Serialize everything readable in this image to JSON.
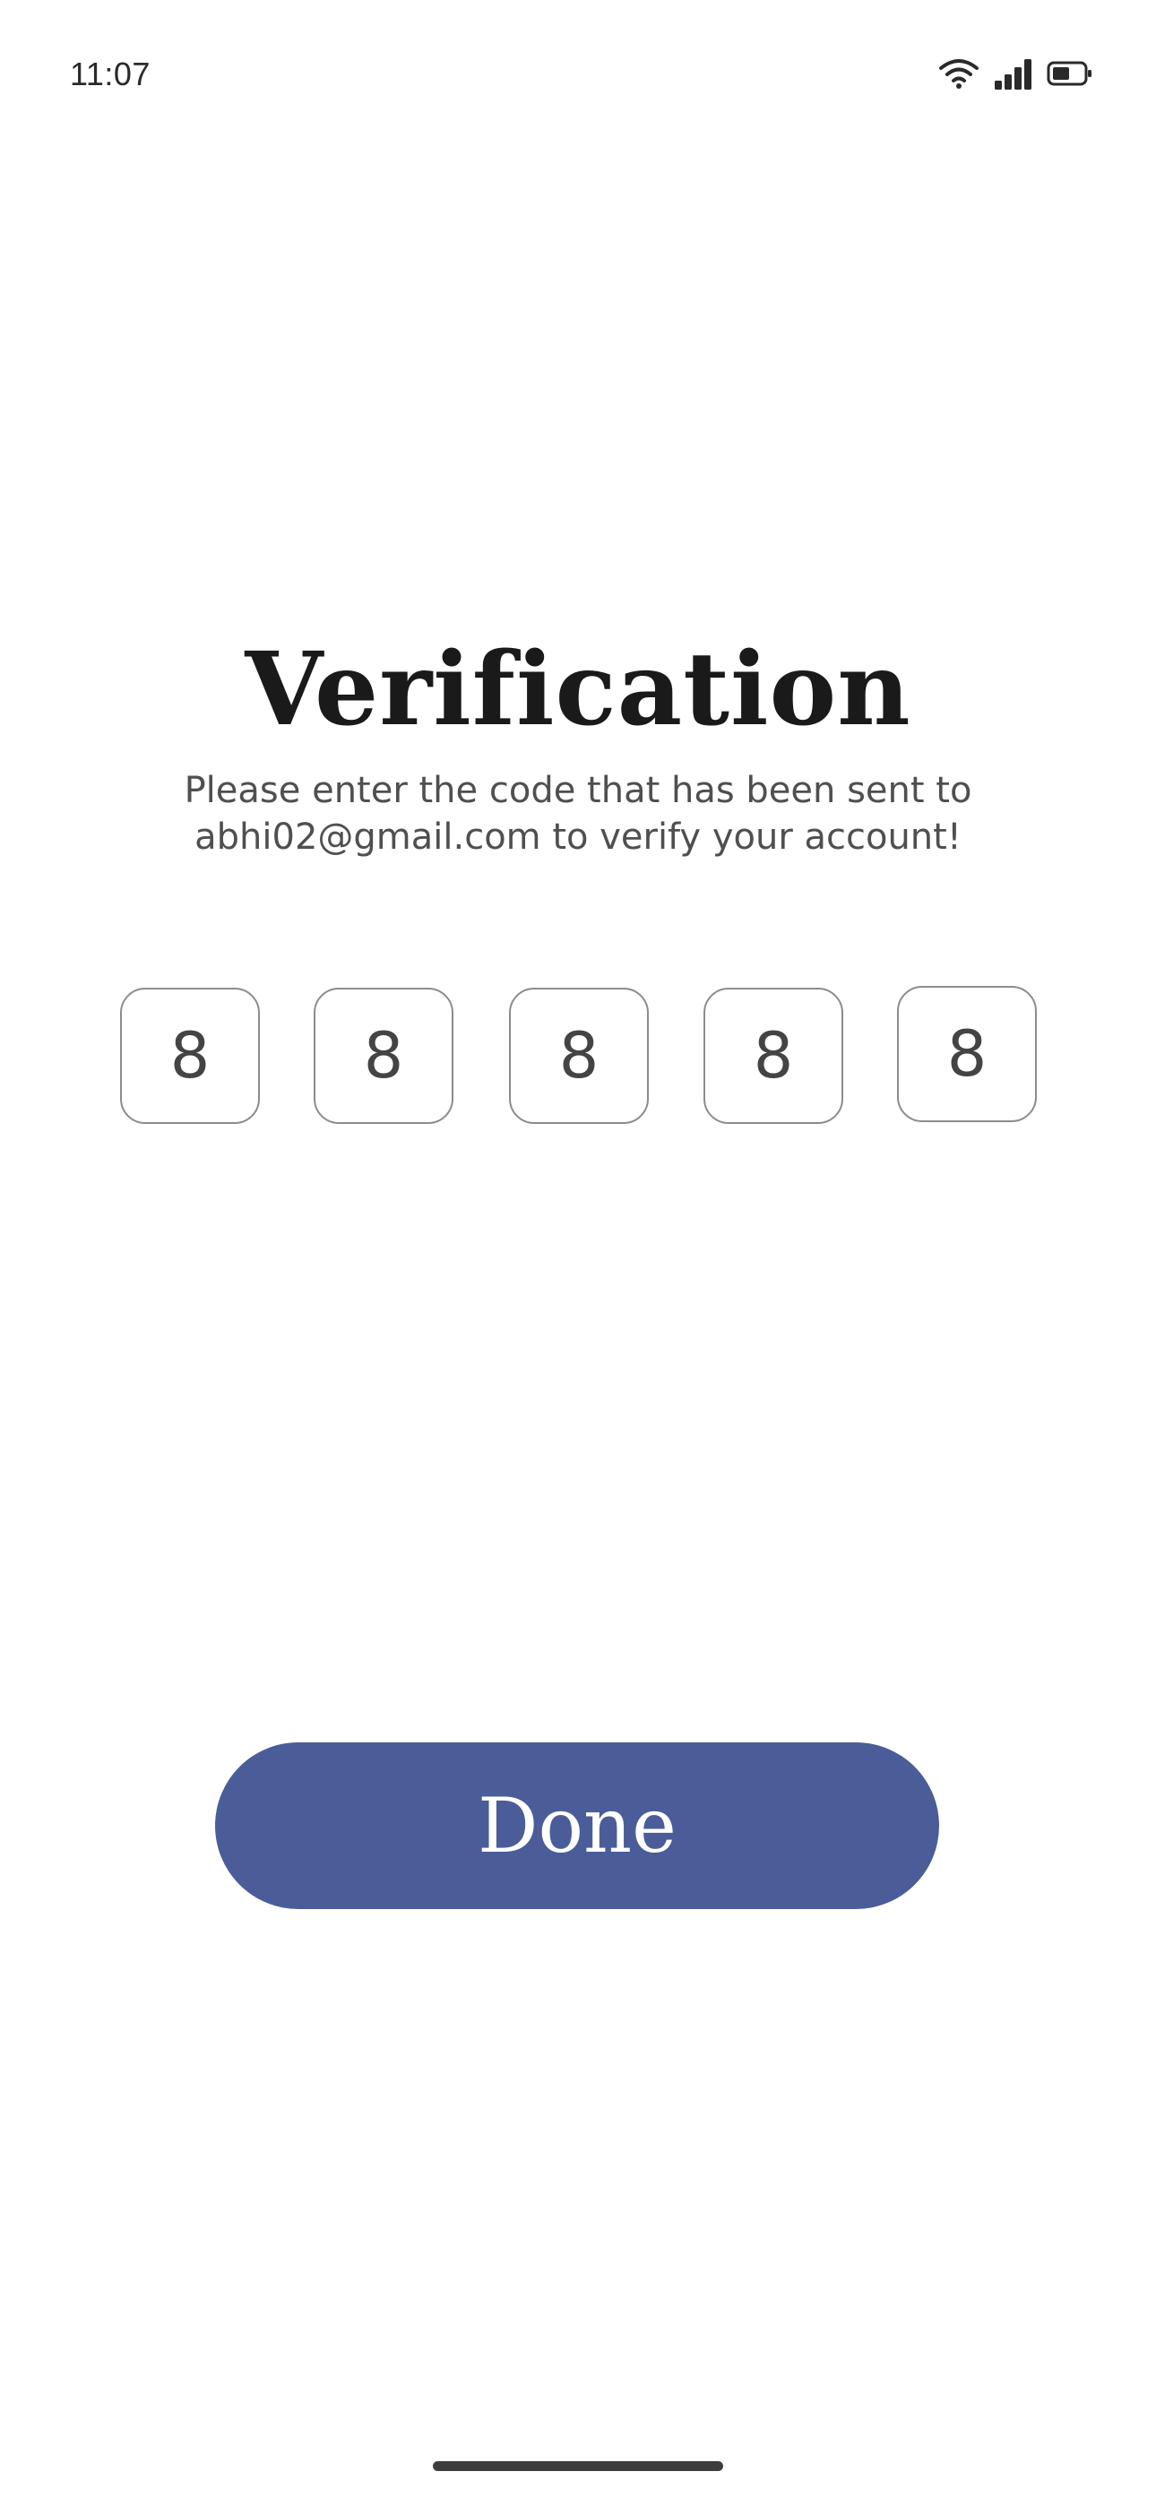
{
  "status_bar": {
    "time": "11:07",
    "icons": [
      "wifi-icon",
      "signal-icon",
      "battery-icon"
    ],
    "battery_level_fraction": 0.45
  },
  "screen": {
    "title": "Verification",
    "subtitle_line1": "Please enter the code that has been sent to",
    "subtitle_line2": "abhi02@gmail.com to verify your account!"
  },
  "code_inputs": {
    "digits": [
      "8",
      "8",
      "8",
      "8",
      "8"
    ]
  },
  "actions": {
    "done_label": "Done"
  },
  "colors": {
    "button_background": "#4a5d98",
    "button_text": "#ffffff",
    "title_text": "#1a1a1a",
    "subtitle_text": "#4f4f4f",
    "input_border": "#8c8c8c"
  }
}
